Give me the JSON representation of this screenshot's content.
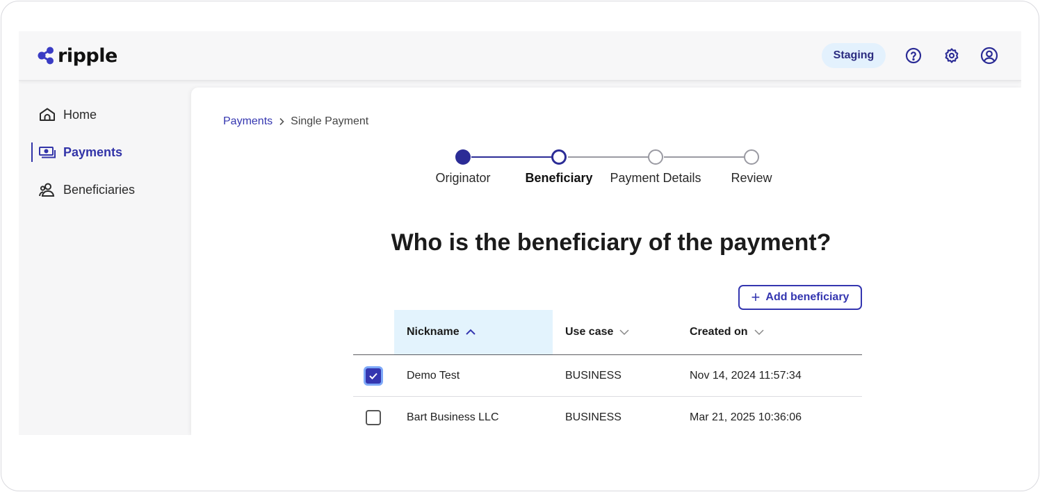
{
  "header": {
    "logo_text": "ripple",
    "environment": "Staging",
    "icons": [
      "help-icon",
      "settings-icon",
      "account-icon"
    ]
  },
  "sidebar": {
    "items": [
      {
        "label": "Home",
        "icon": "home-icon",
        "active": false
      },
      {
        "label": "Payments",
        "icon": "payments-icon",
        "active": true
      },
      {
        "label": "Beneficiaries",
        "icon": "beneficiaries-icon",
        "active": false
      }
    ]
  },
  "breadcrumb": {
    "parent": "Payments",
    "current": "Single Payment"
  },
  "stepper": {
    "steps": [
      {
        "label": "Originator",
        "state": "done"
      },
      {
        "label": "Beneficiary",
        "state": "current"
      },
      {
        "label": "Payment Details",
        "state": "todo"
      },
      {
        "label": "Review",
        "state": "todo"
      }
    ]
  },
  "main": {
    "title": "Who is the beneficiary of the payment?",
    "add_button_label": "Add beneficiary"
  },
  "table": {
    "columns": [
      {
        "label": "Nickname",
        "sort": "ascending"
      },
      {
        "label": "Use case",
        "sort": "none"
      },
      {
        "label": "Created on",
        "sort": "none"
      }
    ],
    "rows": [
      {
        "checked": true,
        "nickname": "Demo Test",
        "use_case": "BUSINESS",
        "created_on": "Nov 14, 2024 11:57:34"
      },
      {
        "checked": false,
        "nickname": "Bart Business LLC",
        "use_case": "BUSINESS",
        "created_on": "Mar 21, 2025 10:36:06"
      }
    ]
  },
  "colors": {
    "brand": "#3436b0",
    "stepper_active": "#2b2c96",
    "badge_bg": "#e3f1fd",
    "sorted_header_bg": "#e3f3fd",
    "checkbox_focus": "#7ea9f8"
  }
}
